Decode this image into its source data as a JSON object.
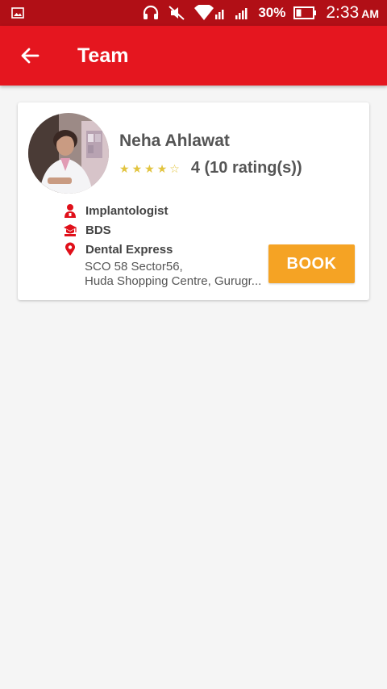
{
  "status_bar": {
    "battery": "30%",
    "time": "2:33",
    "ampm": "AM",
    "icons": [
      "gallery-icon",
      "headset-icon",
      "mute-icon",
      "wifi-icon",
      "signal-icon",
      "signal-icon",
      "battery-icon"
    ]
  },
  "app_bar": {
    "title": "Team",
    "back_icon": "arrow-left-icon"
  },
  "doctor": {
    "name": "Neha Ahlawat",
    "rating_value": 4,
    "rating_max": 5,
    "rating_text": "4 (10 rating(s))",
    "specialty": "Implantologist",
    "degree": "BDS",
    "clinic": "Dental Express",
    "address_line1": "SCO 58 Sector56,",
    "address_line2": "Huda Shopping Centre, Gurugr...",
    "book_label": "BOOK"
  },
  "colors": {
    "status_bar": "#b10f16",
    "app_bar": "#e5161f",
    "book_button": "#f5a324",
    "stars": "#e2c43f",
    "info_icons": "#e0101a",
    "background": "#f5f5f5"
  }
}
